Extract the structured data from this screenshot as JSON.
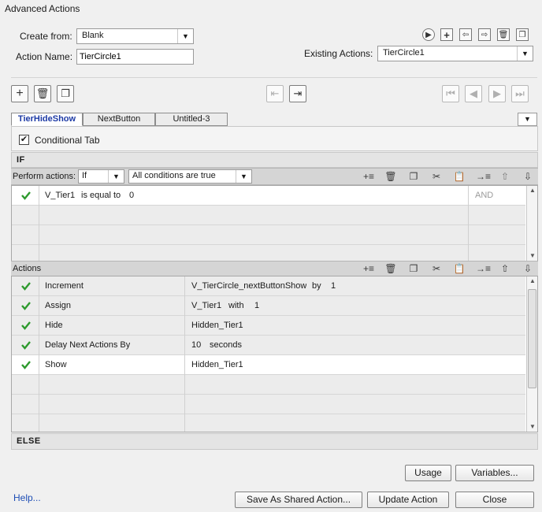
{
  "window": {
    "title": "Advanced Actions"
  },
  "form": {
    "create_from_label": "Create from:",
    "create_from_value": "Blank",
    "action_name_label": "Action Name:",
    "action_name_value": "TierCircle1",
    "existing_actions_label": "Existing Actions:",
    "existing_actions_value": "TierCircle1"
  },
  "tabs": [
    {
      "label": "TierHideShow",
      "active": true
    },
    {
      "label": "NextButton",
      "active": false
    },
    {
      "label": "Untitled-3",
      "active": false
    }
  ],
  "conditional_tab": {
    "label": "Conditional Tab",
    "checked": true
  },
  "if_section": {
    "header": "IF",
    "perform_label": "Perform actions:",
    "perform_value": "If",
    "conditions_value": "All conditions are true",
    "rows": [
      {
        "variable": "V_Tier1",
        "operator": "is equal to",
        "value": "0",
        "logic": "AND"
      }
    ]
  },
  "actions_section": {
    "header": "Actions",
    "rows": [
      {
        "action": "Increment",
        "target": "V_TierCircle_nextButtonShow",
        "mid": "by",
        "value": "1"
      },
      {
        "action": "Assign",
        "target": "V_Tier1",
        "mid": "with",
        "value": "1"
      },
      {
        "action": "Hide",
        "target": "Hidden_Tier1",
        "mid": "",
        "value": ""
      },
      {
        "action": "Delay Next Actions By",
        "target": "10",
        "mid": "seconds",
        "value": ""
      },
      {
        "action": "Show",
        "target": "Hidden_Tier1",
        "mid": "",
        "value": ""
      }
    ]
  },
  "else_section": {
    "header": "ELSE"
  },
  "buttons": {
    "usage": "Usage",
    "variables": "Variables...",
    "help": "Help...",
    "save_shared": "Save As Shared Action...",
    "update": "Update Action",
    "close": "Close"
  },
  "colors": {
    "check": "#2e9a2e",
    "tab_active": "#1d3aa5",
    "link": "#1d4db5"
  }
}
